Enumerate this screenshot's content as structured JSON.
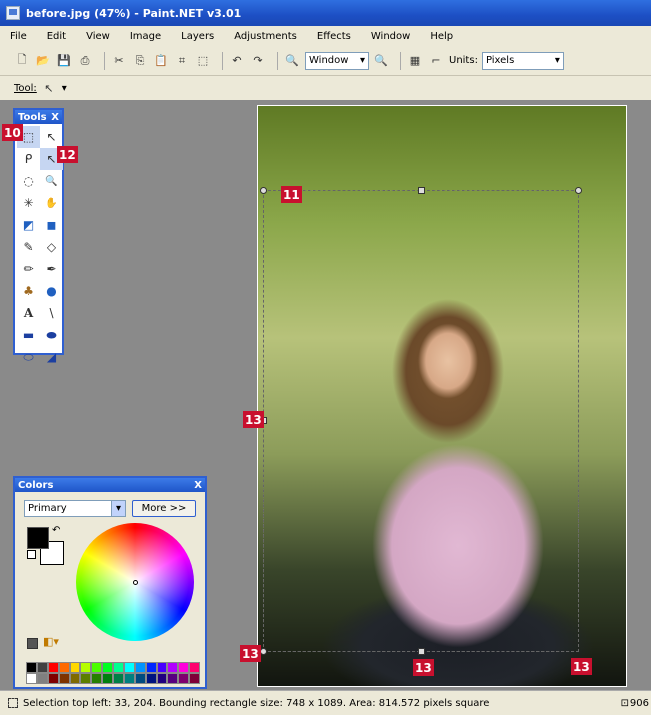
{
  "window": {
    "title": "before.jpg (47%) - Paint.NET v3.01"
  },
  "menus": [
    "File",
    "Edit",
    "View",
    "Image",
    "Layers",
    "Adjustments",
    "Effects",
    "Window",
    "Help"
  ],
  "toolbar": {
    "zoom_value": "Window",
    "units_label": "Units:",
    "units_value": "Pixels"
  },
  "toolbar2": {
    "tool_label": "Tool:"
  },
  "tools_panel": {
    "title": "Tools",
    "close": "X",
    "tools": [
      "rectangle-select",
      "move-selection",
      "lasso-select",
      "move-selected",
      "ellipse-select",
      "zoom",
      "magic-wand",
      "pan",
      "paint-bucket",
      "gradient",
      "paintbrush",
      "eraser",
      "pencil",
      "color-picker",
      "clone-stamp",
      "recolor",
      "text",
      "line-curve",
      "rectangle",
      "rounded-rectangle",
      "ellipse",
      "freeform-shape"
    ],
    "glyphs": [
      "⬚",
      "↖",
      "ᑭ",
      "↖",
      "◌",
      "🔍",
      "✳",
      "✋",
      "◩",
      "◼",
      "✎",
      "◇",
      "✏",
      "✒",
      "♣",
      "●",
      "A",
      "\\",
      "▬",
      "⬬",
      "⬭",
      "◢"
    ]
  },
  "colors_panel": {
    "title": "Colors",
    "close": "X",
    "mode_value": "Primary",
    "more_button": "More >>",
    "primary_color": "#000000",
    "secondary_color": "#ffffff",
    "palette_top": [
      "#000000",
      "#404040",
      "#ff0000",
      "#ff6a00",
      "#ffd800",
      "#b6ff00",
      "#4cff00",
      "#00ff21",
      "#00ff90",
      "#00ffff",
      "#0094ff",
      "#0026ff",
      "#4800ff",
      "#b200ff",
      "#ff00dc",
      "#ff006e"
    ],
    "palette_bottom": [
      "#ffffff",
      "#808080",
      "#7f0000",
      "#7f3300",
      "#7f6a00",
      "#5b7f00",
      "#267f00",
      "#007f0e",
      "#007f46",
      "#007f7f",
      "#004a7f",
      "#00137f",
      "#21007f",
      "#57007f",
      "#7f006e",
      "#7f0037"
    ]
  },
  "callouts": {
    "c10": "10",
    "c11": "11",
    "c12": "12",
    "c13a": "13",
    "c13b": "13",
    "c13c": "13",
    "c13d": "13"
  },
  "statusbar": {
    "message": "Selection top left: 33, 204. Bounding rectangle size: 748 x 1089. Area: 814.572 pixels square",
    "right_value": "906"
  },
  "colors": {
    "titlebar": "#1d4fc4",
    "callout": "#c8102e",
    "panel_border": "#2f5fd0"
  }
}
